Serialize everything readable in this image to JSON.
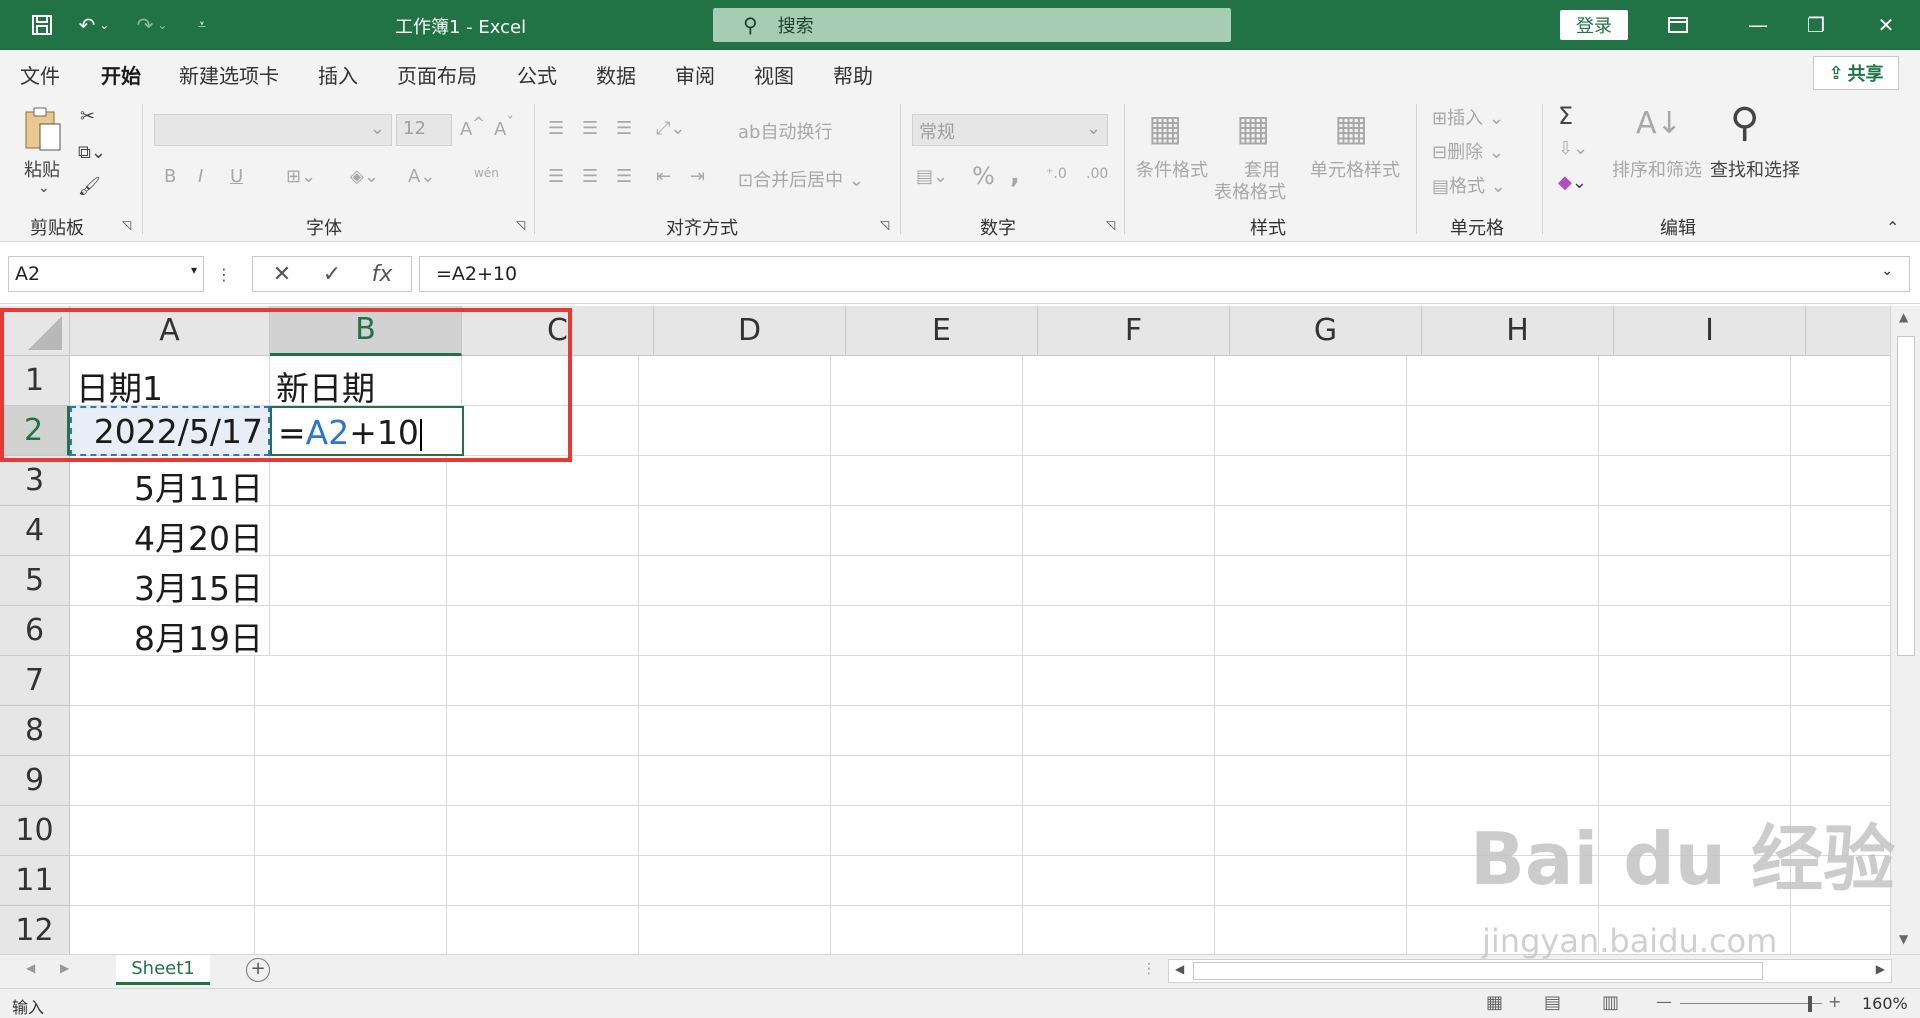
{
  "titlebar": {
    "title": "工作簿1  -  Excel",
    "search_placeholder": "搜索",
    "login": "登录",
    "icons": [
      "save-icon",
      "undo-icon",
      "redo-icon",
      "customize-icon",
      "search-icon",
      "ribbon-display-icon",
      "minimize-icon",
      "restore-icon",
      "close-icon"
    ]
  },
  "menu": {
    "tabs": [
      "文件",
      "开始",
      "新建选项卡",
      "插入",
      "页面布局",
      "公式",
      "数据",
      "审阅",
      "视图",
      "帮助"
    ],
    "active": "开始",
    "share": "共享"
  },
  "ribbon": {
    "clipboard": {
      "paste": "粘贴",
      "label": "剪贴板"
    },
    "font": {
      "size": "12",
      "label": "字体",
      "bold": "B",
      "italic": "I",
      "underline": "U",
      "phonetic": "wén"
    },
    "alignment": {
      "wrap": "自动换行",
      "merge": "合并后居中",
      "label": "对齐方式"
    },
    "number": {
      "format": "常规",
      "percent": "%",
      "comma": ",",
      "label": "数字"
    },
    "styles": {
      "cond": "条件格式",
      "table1": "套用",
      "table2": "表格格式",
      "cell": "单元格样式",
      "label": "样式"
    },
    "cells": {
      "insert": "插入",
      "delete": "删除",
      "format": "格式",
      "label": "单元格"
    },
    "editing": {
      "sum": "Σ",
      "sort": "排序和筛选",
      "find": "查找和选择",
      "label": "编辑"
    }
  },
  "formula_bar": {
    "name_box": "A2",
    "formula": "=A2+10",
    "fx": "fx"
  },
  "grid": {
    "columns": [
      "A",
      "B",
      "C",
      "D",
      "E",
      "F",
      "G",
      "H",
      "I"
    ],
    "rows": [
      "1",
      "2",
      "3",
      "4",
      "5",
      "6",
      "7",
      "8",
      "9",
      "10",
      "11",
      "12"
    ],
    "cells": {
      "A1": "日期1",
      "B1": "新日期",
      "A2": "2022/5/17",
      "B2_eq": "=",
      "B2_ref": "A2",
      "B2_rest": "+10",
      "A3": "5月11日",
      "A4": "4月20日",
      "A5": "3月15日",
      "A6": "8月19日"
    },
    "ref_color": "#2e75d3",
    "highlight_color": "#e53935"
  },
  "sheets": {
    "tabs": [
      "Sheet1"
    ],
    "active": "Sheet1"
  },
  "status": {
    "mode": "输入",
    "zoom": "160%"
  },
  "watermark": {
    "brand": "Bai du 经验",
    "url": "jingyan.baidu.com"
  }
}
